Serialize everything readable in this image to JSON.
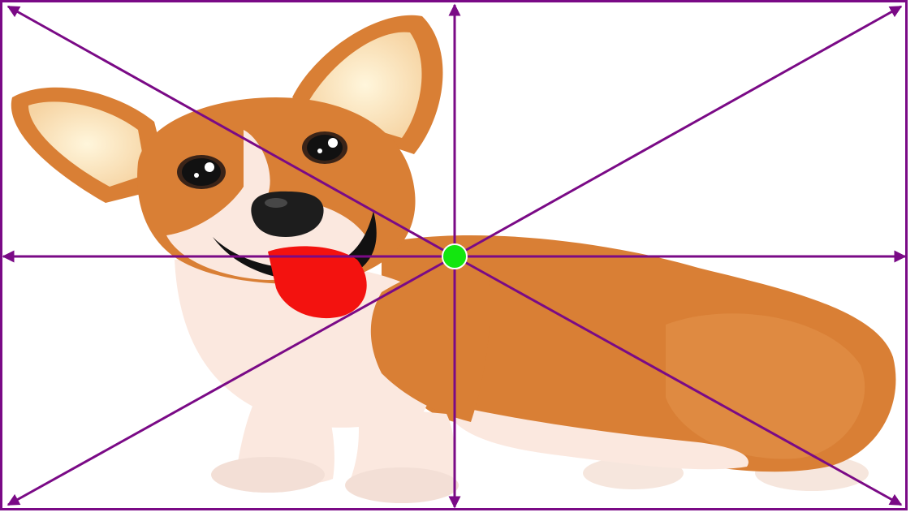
{
  "image": {
    "subject": "cartoon-corgi",
    "colors": {
      "frame": "#7a0a86",
      "arrows": "#7a0a86",
      "center_marker": "#13e60f",
      "fur_orange": "#d97f35",
      "fur_cream": "#fbe8df",
      "tongue": "#f3120f",
      "nose": "#1d1d1d"
    },
    "overlay": {
      "arrow_count": 8,
      "center_marker": "green-dot"
    }
  }
}
